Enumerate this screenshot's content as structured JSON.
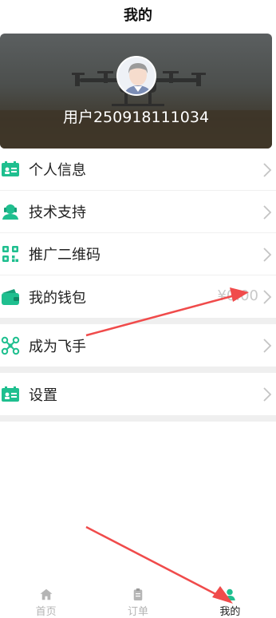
{
  "header": {
    "title": "我的"
  },
  "profile": {
    "username": "用户250918111034"
  },
  "menu": {
    "group1": [
      {
        "label": "个人信息",
        "icon": "id-card-icon"
      },
      {
        "label": "技术支持",
        "icon": "support-user-icon"
      },
      {
        "label": "推广二维码",
        "icon": "qr-code-icon"
      },
      {
        "label": "我的钱包",
        "icon": "wallet-icon",
        "value": "¥0.00"
      }
    ],
    "group2": [
      {
        "label": "成为飞手",
        "icon": "drone-icon"
      }
    ],
    "group3": [
      {
        "label": "设置",
        "icon": "settings-card-icon"
      }
    ]
  },
  "tabbar": [
    {
      "label": "首页",
      "icon": "home-icon",
      "active": false
    },
    {
      "label": "订单",
      "icon": "clipboard-icon",
      "active": false
    },
    {
      "label": "我的",
      "icon": "user-icon",
      "active": true
    }
  ],
  "colors": {
    "accent": "#1fbf8f",
    "arrow": "#f04b4b",
    "separator": "#efefef"
  }
}
